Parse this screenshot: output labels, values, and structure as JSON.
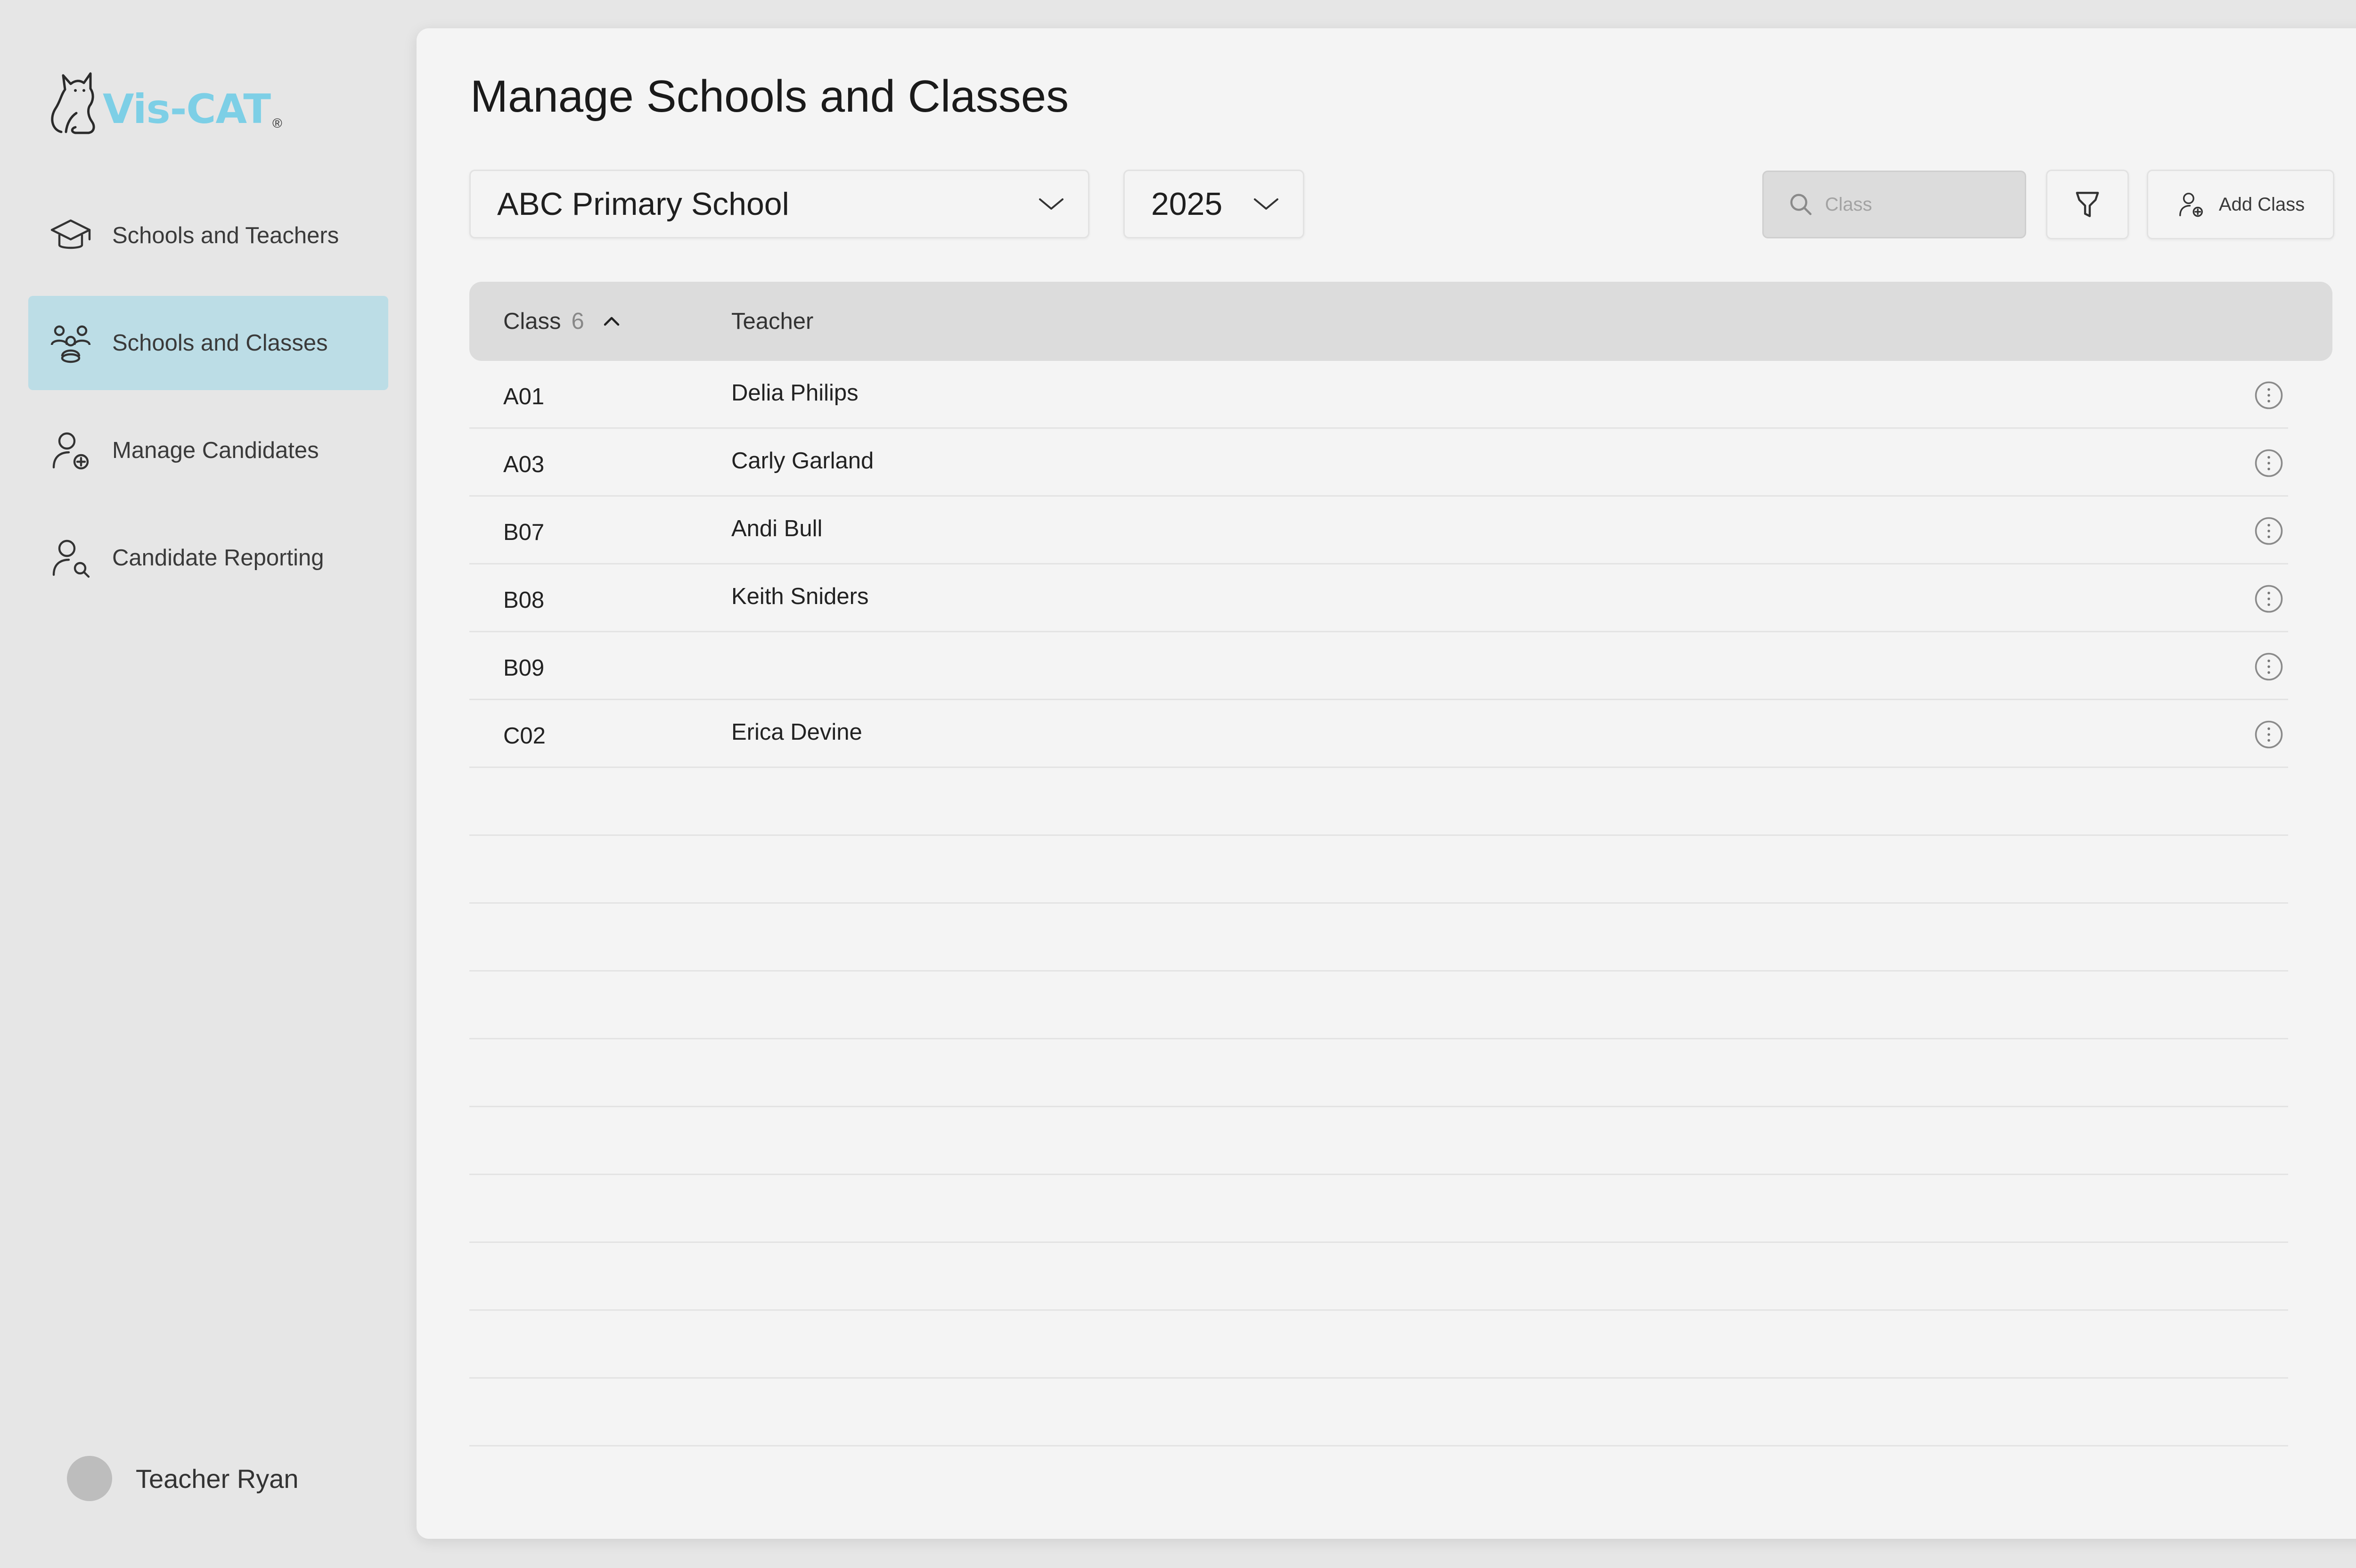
{
  "app": {
    "logo_text": "Vis-CAT",
    "logo_reg": "®"
  },
  "sidebar": {
    "items": [
      {
        "label": "Schools and Teachers",
        "icon": "graduation-cap-icon",
        "active": false
      },
      {
        "label": "Schools and Classes",
        "icon": "group-icon",
        "active": true
      },
      {
        "label": "Manage Candidates",
        "icon": "user-add-icon",
        "active": false
      },
      {
        "label": "Candidate Reporting",
        "icon": "user-search-icon",
        "active": false
      }
    ],
    "user": {
      "name": "Teacher Ryan"
    }
  },
  "main": {
    "title": "Manage Schools and Classes",
    "school_select": {
      "value": "ABC Primary School"
    },
    "year_select": {
      "value": "2025"
    },
    "search": {
      "placeholder": "Class"
    },
    "add_button": {
      "label": "Add Class"
    }
  },
  "table": {
    "headers": {
      "class": "Class",
      "class_count": "6",
      "teacher": "Teacher"
    },
    "rows": [
      {
        "class": "A01",
        "teacher": "Delia Philips"
      },
      {
        "class": "A03",
        "teacher": "Carly Garland"
      },
      {
        "class": "B07",
        "teacher": "Andi Bull"
      },
      {
        "class": "B08",
        "teacher": "Keith Sniders"
      },
      {
        "class": "B09",
        "teacher": ""
      },
      {
        "class": "C02",
        "teacher": "Erica Devine"
      }
    ]
  },
  "colors": {
    "accent": "#7dcfe6",
    "active_nav_bg": "#bcdde6",
    "page_bg": "#e6e6e6",
    "panel_bg": "#f4f4f4",
    "header_bg": "#dcdcdc"
  }
}
